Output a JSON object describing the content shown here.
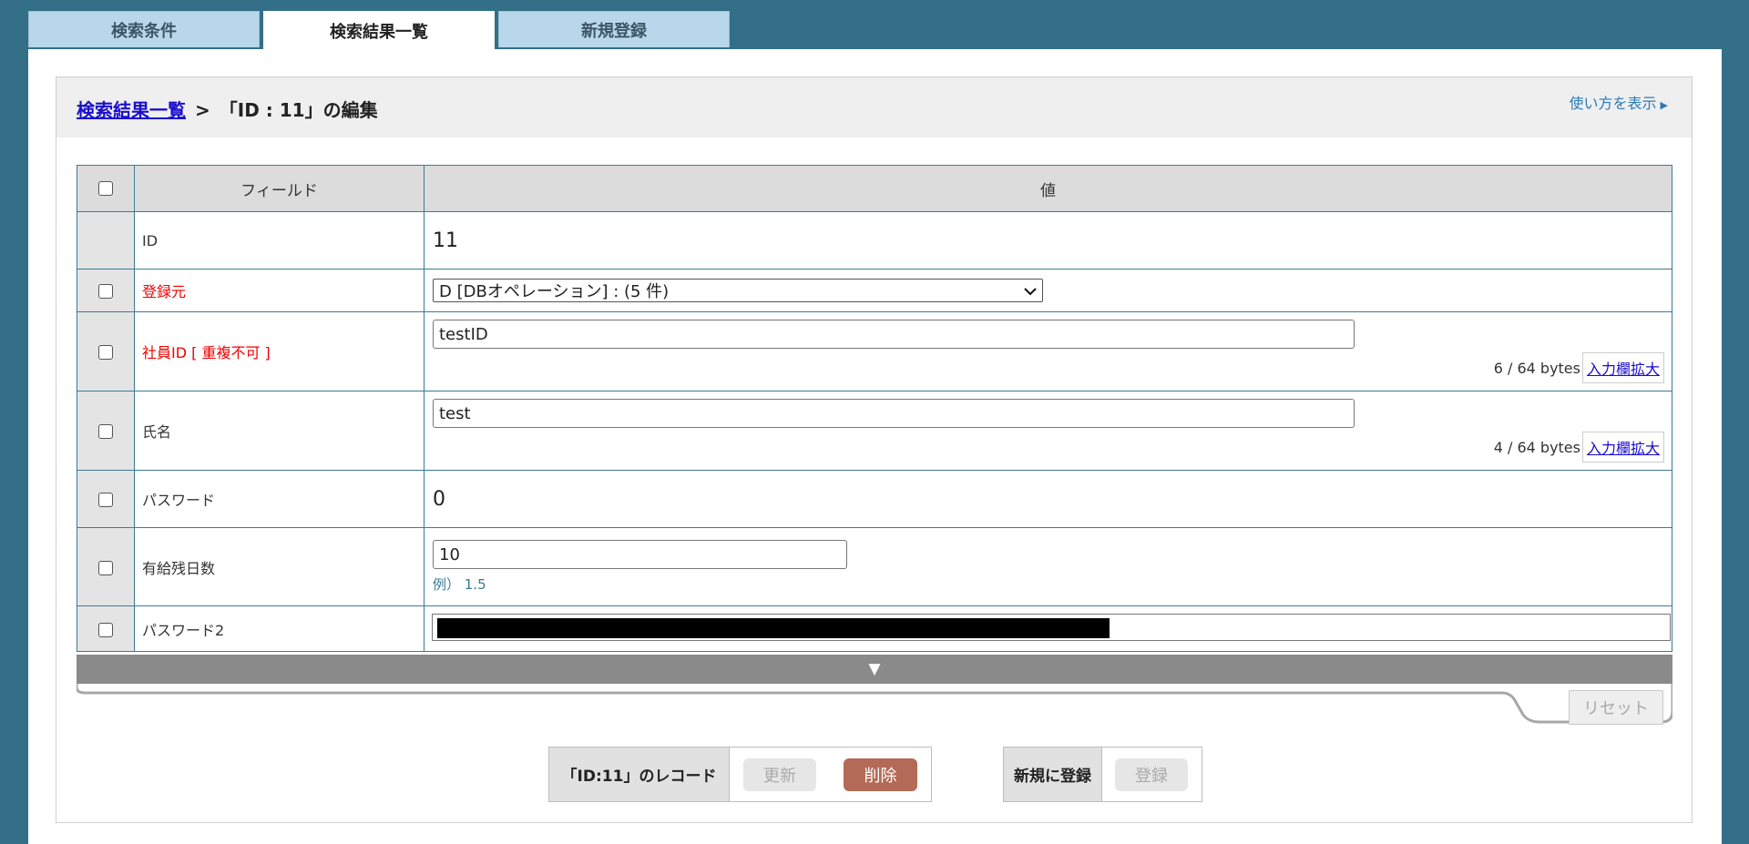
{
  "tabs": [
    "検索条件",
    "検索結果一覧",
    "新規登録"
  ],
  "breadcrumb": {
    "link": "検索結果一覧",
    "sep": ">",
    "current": "「ID : 11」の編集"
  },
  "help": {
    "label": "使い方を表示",
    "arrow": "▶"
  },
  "table": {
    "headers": {
      "field": "フィールド",
      "value": "値"
    },
    "rows": [
      {
        "field": "ID",
        "value": "11"
      },
      {
        "field": "登録元",
        "value": "D [DBオペレーション] : (5 件)"
      },
      {
        "field": "社員ID [ 重複不可 ]",
        "value": "testID",
        "count": "6 / 64 bytes",
        "expand": "入力欄拡大"
      },
      {
        "field": "氏名",
        "value": "test",
        "count": "4 / 64 bytes",
        "expand": "入力欄拡大"
      },
      {
        "field": "パスワード",
        "value": "0"
      },
      {
        "field": "有給残日数",
        "value": "10",
        "example": "例） 1.5"
      },
      {
        "field": "パスワード2"
      }
    ]
  },
  "more": "▼",
  "reset": "リセット",
  "record_group": {
    "label": "「ID:11」のレコード",
    "update": "更新",
    "delete": "削除"
  },
  "new_group": {
    "label": "新規に登録",
    "register": "登録"
  }
}
